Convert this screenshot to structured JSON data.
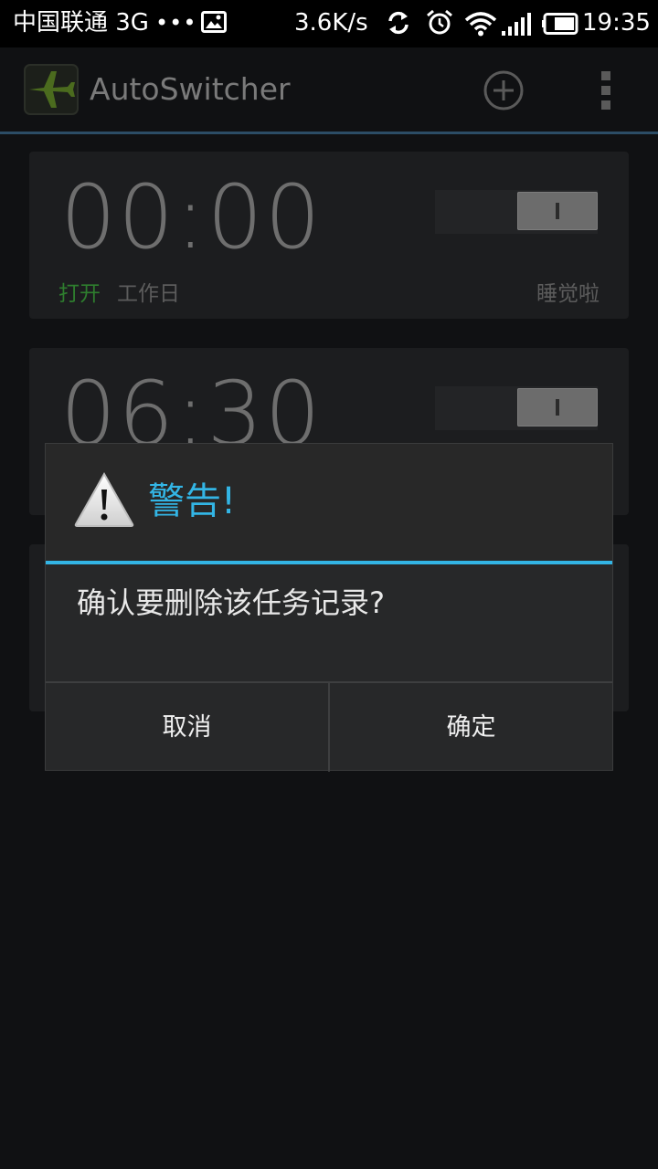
{
  "status_bar": {
    "carrier": "中国联通 3G",
    "dots": "•••",
    "speed": "3.6K/s",
    "time": "19:35",
    "icons": [
      "image-icon",
      "sync-icon",
      "alarm-icon",
      "wifi-icon",
      "signal-icon",
      "battery-icon"
    ]
  },
  "action_bar": {
    "title": "AutoSwitcher",
    "icons": [
      "airplane-app-icon",
      "add-circle-icon",
      "overflow-menu-icon"
    ]
  },
  "tasks": [
    {
      "time": "00:00",
      "status": "打开",
      "days": "工作日",
      "label": "睡觉啦",
      "toggle": "on"
    },
    {
      "time": "06:30",
      "toggle": "on"
    }
  ],
  "dialog": {
    "title": "警告!",
    "message": "确认要删除该任务记录?",
    "cancel_label": "取消",
    "confirm_label": "确定"
  },
  "colors": {
    "accent": "#33b5e5",
    "status_on": "#2e7d2e",
    "background": "#101113"
  }
}
